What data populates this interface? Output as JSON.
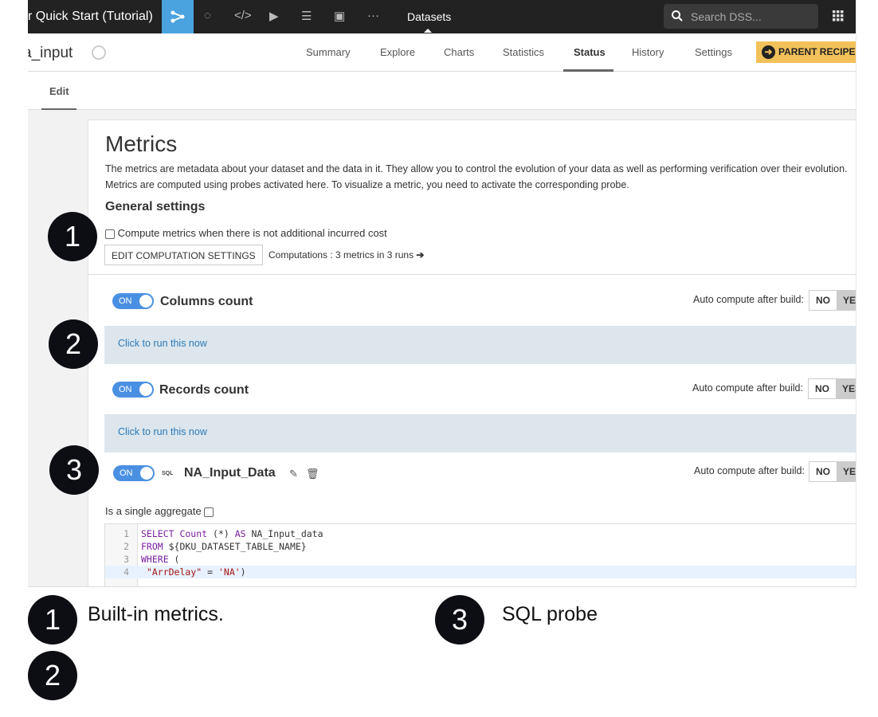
{
  "topbar": {
    "project": "r Quick Start (Tutorial)",
    "section": "Datasets",
    "search_placeholder": "Search DSS...",
    "icons": [
      "flow-icon",
      "recipes-icon",
      "code-icon",
      "run-icon",
      "deploy-icon",
      "dashboard-icon",
      "more-icon"
    ]
  },
  "dataset": {
    "name": "a_input",
    "tabs": [
      "Summary",
      "Explore",
      "Charts",
      "Statistics",
      "Status",
      "History",
      "Settings"
    ],
    "active_tab": "Status",
    "parent_button": "PARENT RECIPE"
  },
  "subtabs": {
    "edit": "Edit"
  },
  "metrics": {
    "title": "Metrics",
    "desc1": "The metrics are metadata about your dataset and the data in it. They allow you to control the evolution of your data as well as performing verification over their evolution.",
    "desc2": "Metrics are computed using probes activated here. To visualize a metric, you need to activate the corresponding probe.",
    "general": "General settings",
    "compute_checkbox": "Compute metrics when there is not additional incurred cost",
    "edit_button": "EDIT COMPUTATION SETTINGS",
    "computations": "Computations : 3 metrics in 3 runs",
    "toggle_on": "ON",
    "auto_label": "Auto compute after build:",
    "no": "NO",
    "yes": "YES",
    "run_link": "Click to run this now",
    "probes": [
      {
        "name": "Columns count"
      },
      {
        "name": "Records count"
      },
      {
        "name": "NA_Input_Data",
        "tag": "SQL"
      }
    ],
    "single_aggregate": "Is a single aggregate",
    "code": [
      "SELECT Count (*) AS NA_Input_data",
      "FROM ${DKU_DATASET_TABLE_NAME}",
      "WHERE (",
      "  \"ArrDelay\" = 'NA')"
    ]
  },
  "annotations": {
    "b1": "1",
    "b2": "2",
    "b3": "3",
    "note1": "Built-in metrics.",
    "note3": "SQL probe"
  }
}
